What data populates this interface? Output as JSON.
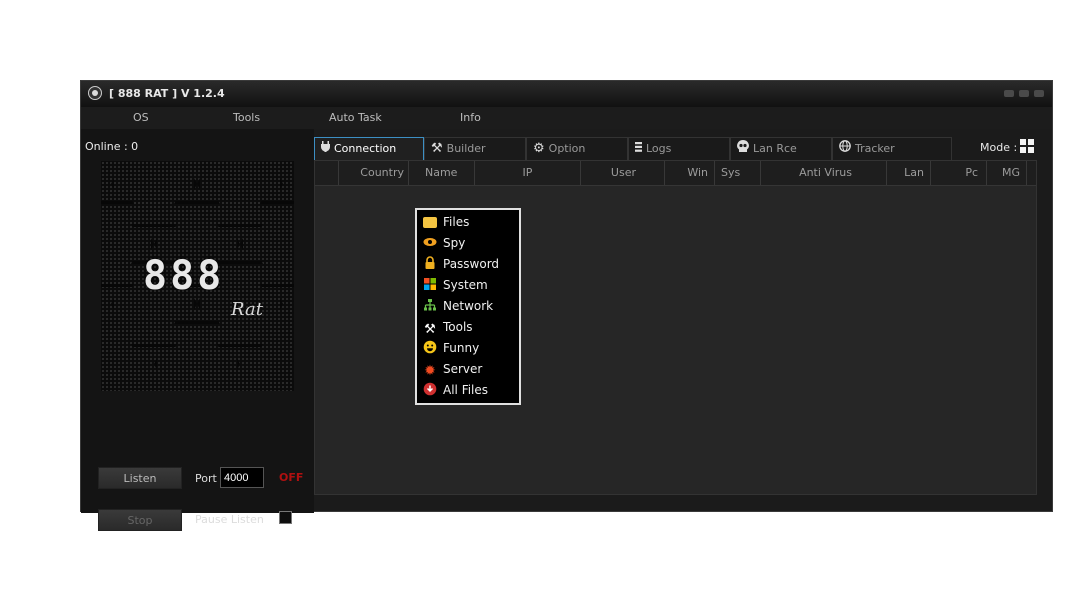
{
  "window": {
    "title": "[ 888 RAT ] V 1.2.4"
  },
  "menu": [
    "OS",
    "Tools",
    "Auto Task",
    "Info"
  ],
  "left_panel": {
    "online": "Online : 0",
    "logo_number": "888",
    "logo_rat": "Rat",
    "listen_button": "Listen",
    "port_label": "Port",
    "port_value": "4000",
    "status": "OFF",
    "stop_button": "Stop",
    "pause_label": "Pause Listen"
  },
  "tabs": [
    {
      "label": "Connection",
      "icon": "plug-icon"
    },
    {
      "label": "Builder",
      "icon": "tools-icon"
    },
    {
      "label": "Option",
      "icon": "gear-icon"
    },
    {
      "label": "Logs",
      "icon": "logs-icon"
    },
    {
      "label": "Lan Rce",
      "icon": "skull-icon"
    },
    {
      "label": "Tracker",
      "icon": "globe-icon"
    }
  ],
  "mode_label": "Mode :",
  "columns": [
    "Country",
    "Name",
    "IP",
    "User",
    "Win",
    "Sys",
    "Anti Virus",
    "Lan",
    "Pc",
    "MG"
  ],
  "context_menu": [
    {
      "label": "Files",
      "icon": "folder-icon",
      "color": "#f4c542"
    },
    {
      "label": "Spy",
      "icon": "eye-icon",
      "color": "#f0a020"
    },
    {
      "label": "Password",
      "icon": "lock-icon",
      "color": "#f0b020"
    },
    {
      "label": "System",
      "icon": "windows-icon",
      "color": "#3aa0e8"
    },
    {
      "label": "Network",
      "icon": "network-icon",
      "color": "#6ac04a"
    },
    {
      "label": "Tools",
      "icon": "tools-icon",
      "color": "#ffffff"
    },
    {
      "label": "Funny",
      "icon": "smiley-icon",
      "color": "#f5c518"
    },
    {
      "label": "Server",
      "icon": "server-icon",
      "color": "#f04a20"
    },
    {
      "label": "All Files",
      "icon": "download-icon",
      "color": "#d03030"
    }
  ]
}
